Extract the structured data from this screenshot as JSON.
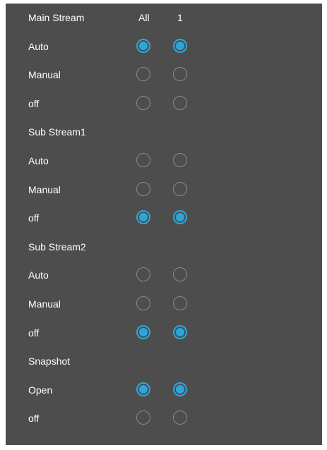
{
  "header": {
    "title": "Main Stream",
    "col_all": "All",
    "col_one": "1"
  },
  "main_stream": {
    "options": [
      {
        "label": "Auto",
        "all": true,
        "ch1": true
      },
      {
        "label": "Manual",
        "all": false,
        "ch1": false
      },
      {
        "label": "off",
        "all": false,
        "ch1": false
      }
    ]
  },
  "sub_stream1": {
    "title": "Sub Stream1",
    "options": [
      {
        "label": "Auto",
        "all": false,
        "ch1": false
      },
      {
        "label": "Manual",
        "all": false,
        "ch1": false
      },
      {
        "label": "off",
        "all": true,
        "ch1": true
      }
    ]
  },
  "sub_stream2": {
    "title": "Sub Stream2",
    "options": [
      {
        "label": "Auto",
        "all": false,
        "ch1": false
      },
      {
        "label": "Manual",
        "all": false,
        "ch1": false
      },
      {
        "label": "off",
        "all": true,
        "ch1": true
      }
    ]
  },
  "snapshot": {
    "title": "Snapshot",
    "options": [
      {
        "label": "Open",
        "all": true,
        "ch1": true
      },
      {
        "label": "off",
        "all": false,
        "ch1": false
      }
    ]
  },
  "colors": {
    "panel_bg": "#4d4d4d",
    "accent": "#29a8e0",
    "radio_border": "#8a8a8a",
    "text": "#ffffff"
  }
}
